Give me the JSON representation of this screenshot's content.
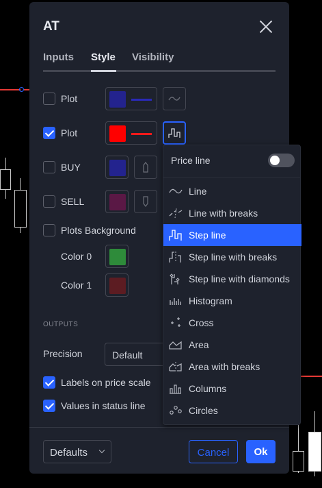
{
  "dialog": {
    "title": "AT",
    "tabs": [
      "Inputs",
      "Style",
      "Visibility"
    ],
    "active_tab": "Style"
  },
  "style_rows": [
    {
      "label": "Plot",
      "checked": false,
      "color": "#23238e",
      "stroke": "#2a2ab8"
    },
    {
      "label": "Plot",
      "checked": true,
      "color": "#ff0000",
      "stroke": "#ff1a1a"
    },
    {
      "label": "BUY",
      "checked": false,
      "color": "#23238e"
    },
    {
      "label": "SELL",
      "checked": false,
      "color": "#5a1845"
    },
    {
      "label": "Plots Background",
      "checked": false
    }
  ],
  "colors": [
    {
      "label": "Color 0",
      "color": "#2e8b3a"
    },
    {
      "label": "Color 1",
      "color": "#5c1c22"
    }
  ],
  "outputs": {
    "section_title": "OUTPUTS",
    "precision_label": "Precision",
    "precision_value": "Default",
    "labels_on_price_scale": "Labels on price scale",
    "values_in_status_line": "Values in status line"
  },
  "footer": {
    "defaults_label": "Defaults",
    "cancel_label": "Cancel",
    "ok_label": "Ok"
  },
  "plot_style_menu": {
    "price_line_label": "Price line",
    "price_line_on": false,
    "selected": "Step line",
    "items": [
      {
        "label": "Line",
        "icon": "line-icon"
      },
      {
        "label": "Line with breaks",
        "icon": "line-with-breaks-icon"
      },
      {
        "label": "Step line",
        "icon": "step-line-icon"
      },
      {
        "label": "Step line with breaks",
        "icon": "step-line-with-breaks-icon"
      },
      {
        "label": "Step line with diamonds",
        "icon": "step-line-with-diamonds-icon"
      },
      {
        "label": "Histogram",
        "icon": "histogram-icon"
      },
      {
        "label": "Cross",
        "icon": "cross-icon"
      },
      {
        "label": "Area",
        "icon": "area-icon"
      },
      {
        "label": "Area with breaks",
        "icon": "area-with-breaks-icon"
      },
      {
        "label": "Columns",
        "icon": "columns-icon"
      },
      {
        "label": "Circles",
        "icon": "circles-icon"
      }
    ]
  },
  "accent": "#2962ff"
}
